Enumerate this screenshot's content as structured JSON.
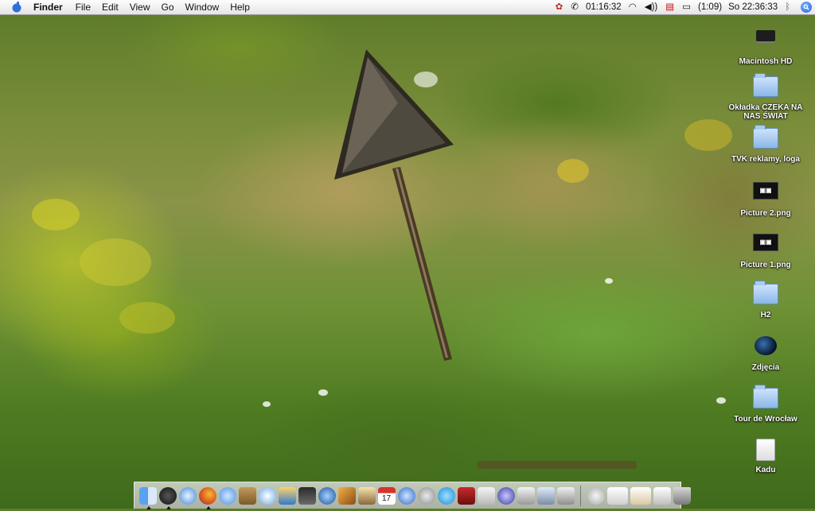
{
  "menubar": {
    "app_name": "Finder",
    "menus": [
      "File",
      "Edit",
      "View",
      "Go",
      "Window",
      "Help"
    ],
    "status": {
      "timer": "01:16:32",
      "battery": "(1:09)",
      "clock": "So 22:36:33"
    }
  },
  "desktop_icons": [
    {
      "label": "Macintosh HD",
      "icon": "hard-drive-icon"
    },
    {
      "label": "Okładka CZEKA NA NAS ŚWIAT",
      "icon": "folder-icon"
    },
    {
      "label": "TVK reklamy, loga",
      "icon": "folder-icon"
    },
    {
      "label": "Picture 2.png",
      "icon": "image-file-icon"
    },
    {
      "label": "Picture 1.png",
      "icon": "image-file-icon"
    },
    {
      "label": "H2",
      "icon": "folder-icon"
    },
    {
      "label": "Zdjęcia",
      "icon": "camera-icon"
    },
    {
      "label": "Tour de Wrocław",
      "icon": "folder-icon"
    },
    {
      "label": "Kadu",
      "icon": "disk-image-icon"
    }
  ],
  "colors": {
    "menubar_bg": "#eeeeee",
    "folder_blue": "#8ab7e8",
    "spotlight_blue": "#1d5fd8"
  }
}
